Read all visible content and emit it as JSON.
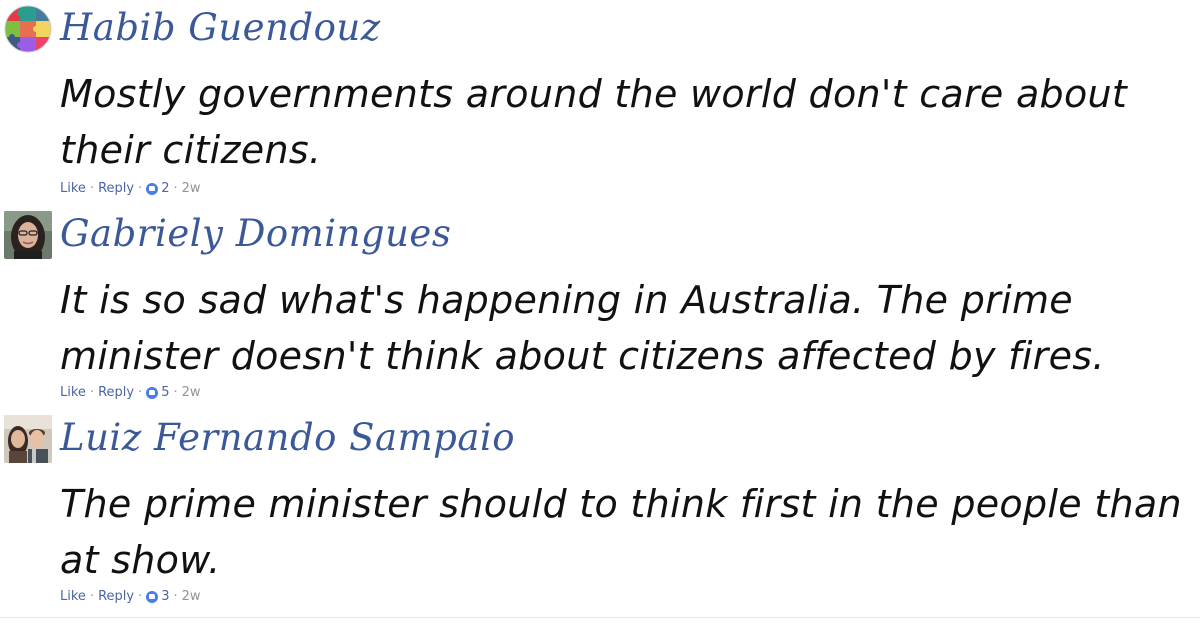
{
  "comments": [
    {
      "author": "Habib Guendouz",
      "text": "Mostly governments around the world don't care about their citizens.",
      "like_label": "Like",
      "reply_label": "Reply",
      "reactions": "2",
      "age": "2w",
      "avatar_icon": "puzzle-avatar"
    },
    {
      "author": "Gabriely Domingues",
      "text": "It is so sad what's happening in Australia. The prime minister doesn't think about citizens affected by fires.",
      "like_label": "Like",
      "reply_label": "Reply",
      "reactions": "5",
      "age": "2w",
      "avatar_icon": "person-photo-avatar"
    },
    {
      "author": "Luiz Fernando Sampaio",
      "text": "The prime minister should to think first in the people than at show.",
      "like_label": "Like",
      "reply_label": "Reply",
      "reactions": "3",
      "age": "2w",
      "avatar_icon": "couple-photo-avatar"
    }
  ],
  "separator": "·",
  "colors": {
    "author": "#3b5998",
    "link": "#4b67a1",
    "meta": "#90949c",
    "like_icon": "#4b7bec",
    "text": "#111111"
  }
}
